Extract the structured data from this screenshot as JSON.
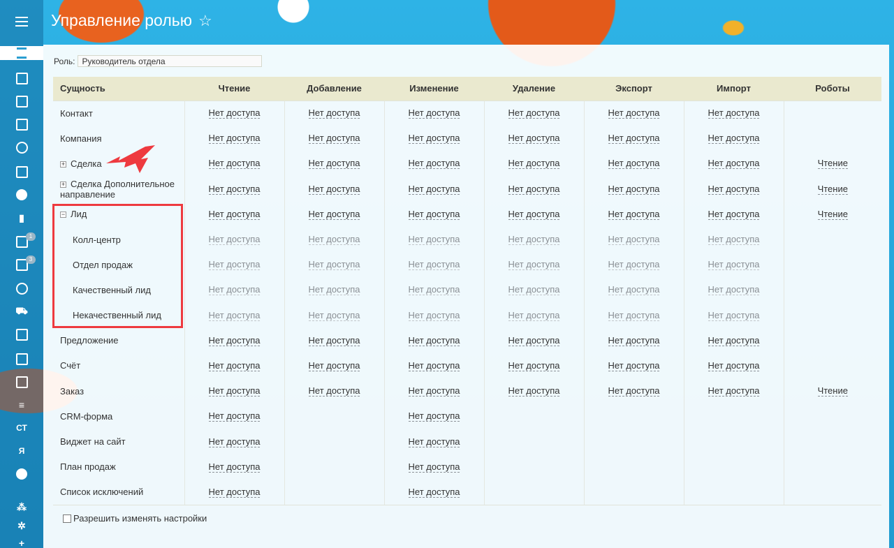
{
  "header": {
    "title": "Управление ролью"
  },
  "sidebar": {
    "badges": {
      "tasks": "1",
      "mail": "3"
    },
    "letters": {
      "ct": "СТ",
      "ya": "Я"
    }
  },
  "role": {
    "label": "Роль:",
    "value": "Руководитель отдела"
  },
  "table": {
    "columns": [
      "Сущность",
      "Чтение",
      "Добавление",
      "Изменение",
      "Удаление",
      "Экспорт",
      "Импорт",
      "Роботы"
    ],
    "rows": [
      {
        "entity": "Контакт",
        "toggle": "",
        "sub": false,
        "cells": [
          "Нет доступа",
          "Нет доступа",
          "Нет доступа",
          "Нет доступа",
          "Нет доступа",
          "Нет доступа",
          ""
        ]
      },
      {
        "entity": "Компания",
        "toggle": "",
        "sub": false,
        "cells": [
          "Нет доступа",
          "Нет доступа",
          "Нет доступа",
          "Нет доступа",
          "Нет доступа",
          "Нет доступа",
          ""
        ]
      },
      {
        "entity": "Сделка",
        "toggle": "+",
        "sub": false,
        "cells": [
          "Нет доступа",
          "Нет доступа",
          "Нет доступа",
          "Нет доступа",
          "Нет доступа",
          "Нет доступа",
          "Чтение"
        ]
      },
      {
        "entity": "Сделка Дополнительное направление",
        "toggle": "+",
        "sub": false,
        "cells": [
          "Нет доступа",
          "Нет доступа",
          "Нет доступа",
          "Нет доступа",
          "Нет доступа",
          "Нет доступа",
          "Чтение"
        ]
      },
      {
        "entity": "Лид",
        "toggle": "−",
        "sub": false,
        "cells": [
          "Нет доступа",
          "Нет доступа",
          "Нет доступа",
          "Нет доступа",
          "Нет доступа",
          "Нет доступа",
          "Чтение"
        ]
      },
      {
        "entity": "Колл-центр",
        "toggle": "",
        "sub": true,
        "cells": [
          "Нет доступа",
          "Нет доступа",
          "Нет доступа",
          "Нет доступа",
          "Нет доступа",
          "Нет доступа",
          ""
        ]
      },
      {
        "entity": "Отдел продаж",
        "toggle": "",
        "sub": true,
        "cells": [
          "Нет доступа",
          "Нет доступа",
          "Нет доступа",
          "Нет доступа",
          "Нет доступа",
          "Нет доступа",
          ""
        ]
      },
      {
        "entity": "Качественный лид",
        "toggle": "",
        "sub": true,
        "cells": [
          "Нет доступа",
          "Нет доступа",
          "Нет доступа",
          "Нет доступа",
          "Нет доступа",
          "Нет доступа",
          ""
        ]
      },
      {
        "entity": "Некачественный лид",
        "toggle": "",
        "sub": true,
        "cells": [
          "Нет доступа",
          "Нет доступа",
          "Нет доступа",
          "Нет доступа",
          "Нет доступа",
          "Нет доступа",
          ""
        ]
      },
      {
        "entity": "Предложение",
        "toggle": "",
        "sub": false,
        "cells": [
          "Нет доступа",
          "Нет доступа",
          "Нет доступа",
          "Нет доступа",
          "Нет доступа",
          "Нет доступа",
          ""
        ]
      },
      {
        "entity": "Счёт",
        "toggle": "",
        "sub": false,
        "cells": [
          "Нет доступа",
          "Нет доступа",
          "Нет доступа",
          "Нет доступа",
          "Нет доступа",
          "Нет доступа",
          ""
        ]
      },
      {
        "entity": "Заказ",
        "toggle": "",
        "sub": false,
        "cells": [
          "Нет доступа",
          "Нет доступа",
          "Нет доступа",
          "Нет доступа",
          "Нет доступа",
          "Нет доступа",
          "Чтение"
        ]
      },
      {
        "entity": "CRM-форма",
        "toggle": "",
        "sub": false,
        "cells": [
          "Нет доступа",
          "",
          "Нет доступа",
          "",
          "",
          "",
          ""
        ]
      },
      {
        "entity": "Виджет на сайт",
        "toggle": "",
        "sub": false,
        "cells": [
          "Нет доступа",
          "",
          "Нет доступа",
          "",
          "",
          "",
          ""
        ]
      },
      {
        "entity": "План продаж",
        "toggle": "",
        "sub": false,
        "cells": [
          "Нет доступа",
          "",
          "Нет доступа",
          "",
          "",
          "",
          ""
        ]
      },
      {
        "entity": "Список исключений",
        "toggle": "",
        "sub": false,
        "cells": [
          "Нет доступа",
          "",
          "Нет доступа",
          "",
          "",
          "",
          ""
        ]
      }
    ]
  },
  "footer": {
    "allow_edit_label": "Разрешить изменять настройки",
    "allow_edit_checked": false
  },
  "colors": {
    "header_bg": "#eae9cf",
    "highlight": "#ee3a3f",
    "accent": "#2a9ed1"
  }
}
